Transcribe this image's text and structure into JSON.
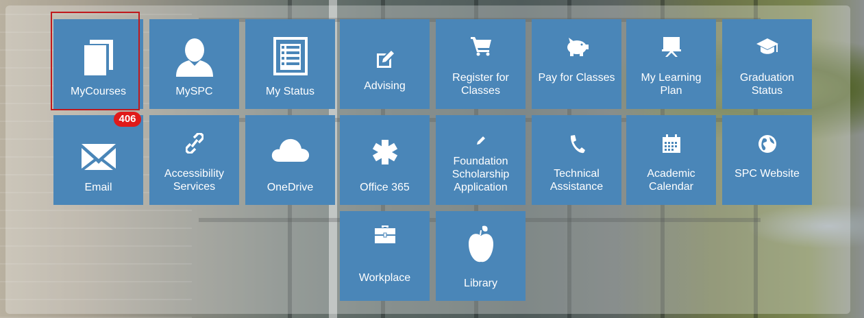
{
  "tiles": [
    {
      "id": "mycourses",
      "label": "MyCourses",
      "icon": "book-icon"
    },
    {
      "id": "myspc",
      "label": "MySPC",
      "icon": "user-icon"
    },
    {
      "id": "mystatus",
      "label": "My Status",
      "icon": "list-icon"
    },
    {
      "id": "advising",
      "label": "Advising",
      "icon": "edit-square-icon"
    },
    {
      "id": "register",
      "label": "Register for Classes",
      "icon": "cart-icon"
    },
    {
      "id": "pay",
      "label": "Pay for Classes",
      "icon": "piggy-bank-icon"
    },
    {
      "id": "learningplan",
      "label": "My Learning Plan",
      "icon": "easel-icon"
    },
    {
      "id": "graduation",
      "label": "Graduation Status",
      "icon": "graduation-cap-icon"
    },
    {
      "id": "email",
      "label": "Email",
      "icon": "envelope-icon"
    },
    {
      "id": "accessibility",
      "label": "Accessibility Services",
      "icon": "link-icon"
    },
    {
      "id": "onedrive",
      "label": "OneDrive",
      "icon": "cloud-icon"
    },
    {
      "id": "office365",
      "label": "Office 365",
      "icon": "asterisk-icon"
    },
    {
      "id": "foundation",
      "label": "Foundation Scholarship Application",
      "icon": "pencil-icon"
    },
    {
      "id": "technical",
      "label": "Technical Assistance",
      "icon": "phone-icon"
    },
    {
      "id": "calendar",
      "label": "Academic Calendar",
      "icon": "calendar-icon"
    },
    {
      "id": "website",
      "label": "SPC Website",
      "icon": "globe-icon"
    },
    {
      "id": "workplace",
      "label": "Workplace",
      "icon": "briefcase-icon"
    },
    {
      "id": "library",
      "label": "Library",
      "icon": "apple-icon"
    }
  ],
  "email_badge": "406",
  "colors": {
    "tile": "#4a86b8",
    "badge": "#e01a1a",
    "selection": "#c0181c"
  }
}
